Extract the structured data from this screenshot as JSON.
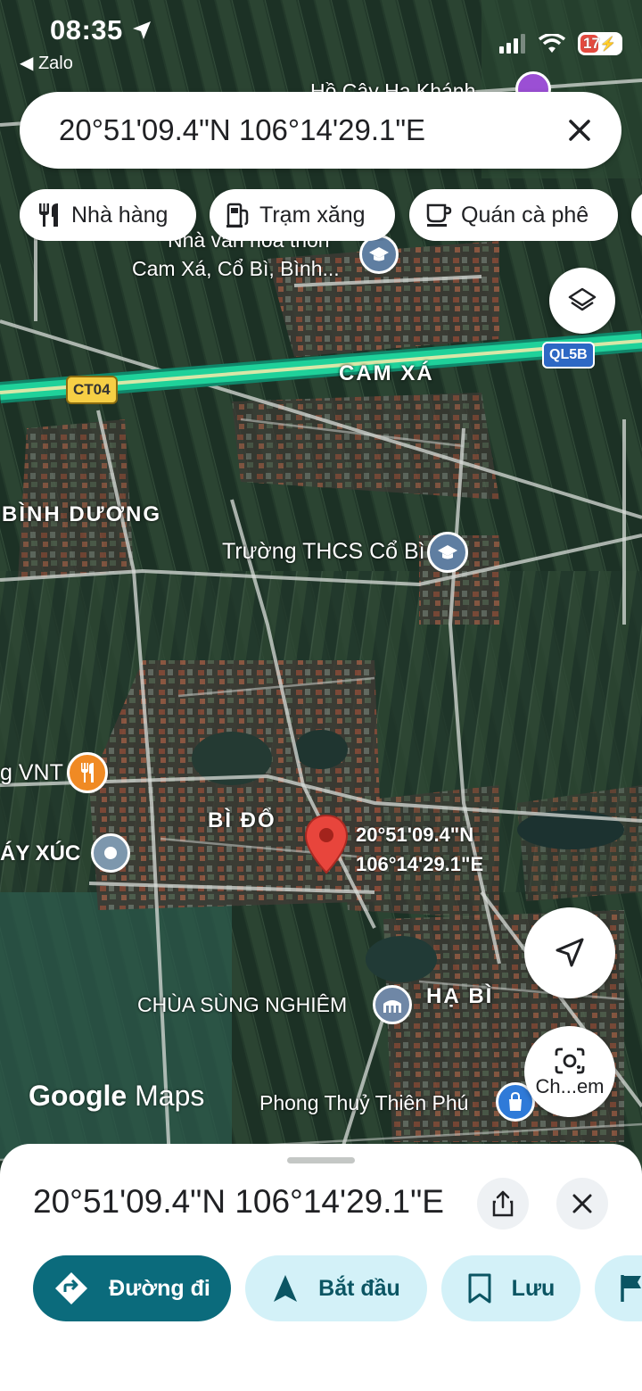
{
  "status_bar": {
    "time": "08:35",
    "back_app": "◀ Zalo",
    "battery": "17"
  },
  "search": {
    "query": "20°51'09.4\"N 106°14'29.1\"E"
  },
  "chips": [
    {
      "label": "Nhà hàng",
      "icon": "fork-knife-icon"
    },
    {
      "label": "Trạm xăng",
      "icon": "gas-station-icon"
    },
    {
      "label": "Quán cà phê",
      "icon": "coffee-icon"
    }
  ],
  "map": {
    "roads": [
      "CT04",
      "QL5B"
    ],
    "places": {
      "top_partial": "Hồ Cây Hạ Khánh",
      "culture_house": "Nhà văn hoá thôn",
      "culture_house_line2": "Cam Xá, Cổ Bì, Bình...",
      "cam_xa": "CAM XÁ",
      "binh_duong": "BÌNH DƯƠNG",
      "school": "Trường THCS Cổ Bì",
      "vnt": "g VNT",
      "bi_do": "BÌ ĐỔ",
      "may_xuc": "ÁY XÚC",
      "pin_line1": "20°51'09.4\"N",
      "pin_line2": "106°14'29.1\"E",
      "pagoda": "CHÙA SÙNG NGHIÊM",
      "ha_bi": "HẠ BÌ",
      "phong_thuy": "Phong Thuỷ Thiên Phú"
    },
    "logo_google": "Google",
    "logo_maps": "Maps",
    "lens_label": "Ch...em"
  },
  "sheet": {
    "coords": "20°51'09.4\"N 106°14'29.1\"E",
    "actions": [
      {
        "label": "Đường đi",
        "icon": "directions-icon"
      },
      {
        "label": "Bắt đầu",
        "icon": "navigation-arrow-icon"
      },
      {
        "label": "Lưu",
        "icon": "bookmark-icon"
      }
    ]
  },
  "colors": {
    "highway": "#1fd19a",
    "pin": "#e8453c",
    "primary_button": "#0b6b7c",
    "secondary_button": "#d3f1f8"
  }
}
